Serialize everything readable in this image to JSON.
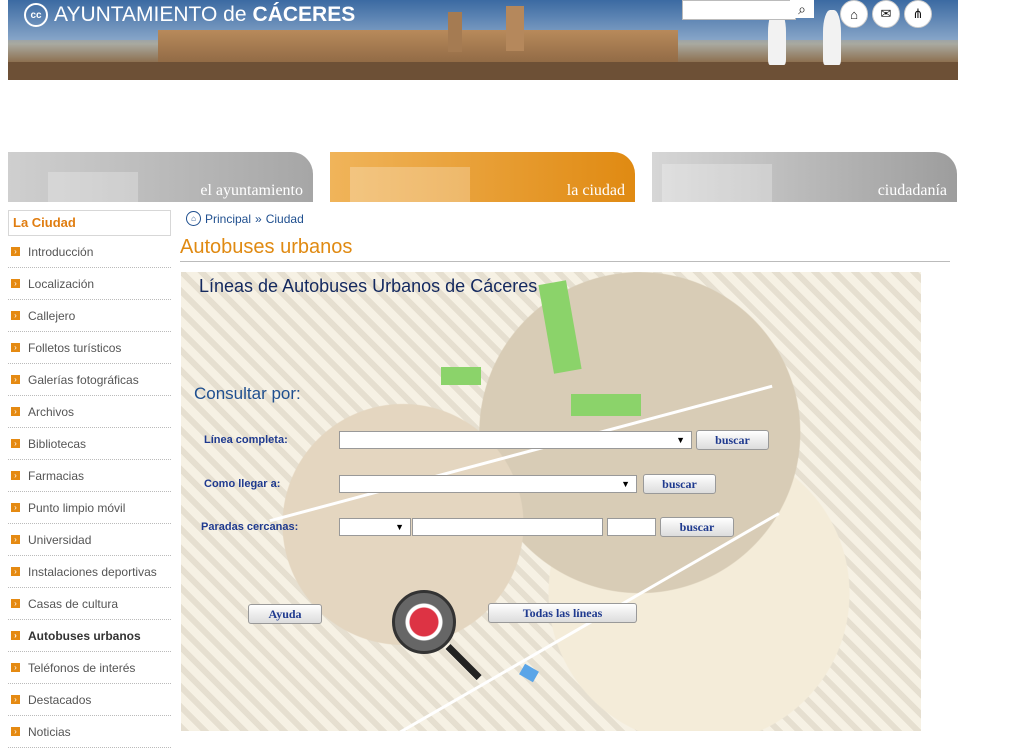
{
  "header": {
    "logo_mark": "cc",
    "logo_text_prefix": "AYUNTAMIENTO de",
    "logo_text_city": "CÁCERES",
    "search": {
      "placeholder": "",
      "button_icon": "search-icon"
    },
    "icons": [
      "home-icon",
      "mail-icon",
      "sitemap-icon"
    ]
  },
  "tabs": [
    {
      "label": "el ayuntamiento"
    },
    {
      "label": "la ciudad"
    },
    {
      "label": "ciudadanía"
    }
  ],
  "sidebar": {
    "title": "La Ciudad",
    "items": [
      {
        "label": "Introducción"
      },
      {
        "label": "Localización"
      },
      {
        "label": "Callejero"
      },
      {
        "label": "Folletos turísticos"
      },
      {
        "label": "Galerías fotográficas"
      },
      {
        "label": "Archivos"
      },
      {
        "label": "Bibliotecas"
      },
      {
        "label": "Farmacias"
      },
      {
        "label": "Punto limpio móvil"
      },
      {
        "label": "Universidad"
      },
      {
        "label": "Instalaciones deportivas"
      },
      {
        "label": "Casas de cultura"
      },
      {
        "label": "Autobuses urbanos",
        "active": true
      },
      {
        "label": "Teléfonos de interés"
      },
      {
        "label": "Destacados"
      },
      {
        "label": "Noticias"
      }
    ]
  },
  "breadcrumb": {
    "home": "Principal",
    "separator": "»",
    "current": "Ciudad"
  },
  "page_title": "Autobuses urbanos",
  "map": {
    "title": "Líneas de Autobuses Urbanos de Cáceres",
    "consult_label": "Consultar por:",
    "linea_label": "Línea completa:",
    "como_label": "Como llegar a:",
    "paradas_label": "Paradas cercanas:",
    "buscar": "buscar",
    "ayuda": "Ayuda",
    "todas": "Todas las líneas"
  },
  "colors": {
    "accent": "#e08a12",
    "link": "#1f4f8f",
    "title": "#14295f"
  }
}
